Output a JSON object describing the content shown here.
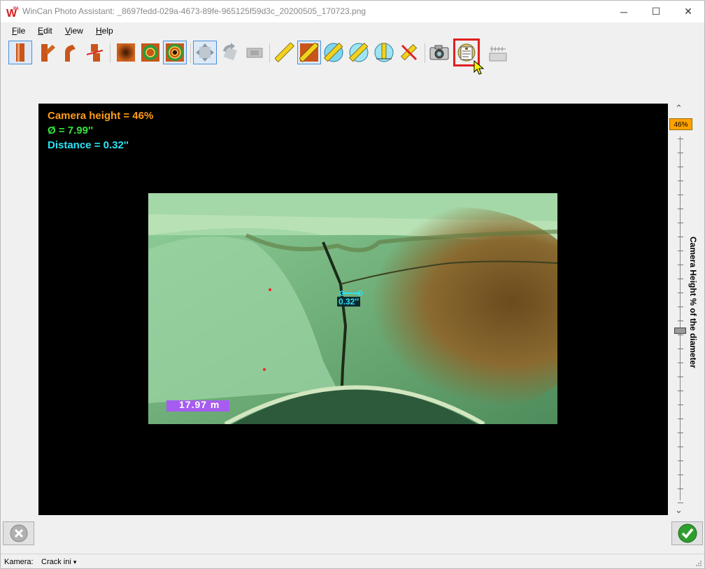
{
  "window": {
    "title": "WinCan Photo Assistant: _8697fedd-029a-4673-89fe-965125f59d3c_20200505_170723.png",
    "minimize_glyph": "─",
    "maximize_glyph": "☐",
    "close_glyph": "✕"
  },
  "menu": {
    "file": {
      "mnemonic": "F",
      "rest": "ile"
    },
    "edit": {
      "mnemonic": "E",
      "rest": "dit"
    },
    "view": {
      "mnemonic": "V",
      "rest": "iew"
    },
    "help": {
      "mnemonic": "H",
      "rest": "elp"
    }
  },
  "toolbar": {
    "icons": [
      "straight-pipe-icon",
      "y-junction-icon",
      "bend-icon",
      "offset-joint-icon",
      "square-view-icon",
      "round-view-icon",
      "round-view-double-icon",
      "move-icon",
      "rotate-icon",
      "frame-icon",
      "measure-ruler-icon",
      "measure-diagonal-icon",
      "measure-circle-icon",
      "measure-circle-alt-icon",
      "measure-height-icon",
      "measure-point-icon",
      "camera-icon",
      "report-icon",
      "scale-icon"
    ],
    "selected": [
      "straight-pipe-icon",
      "round-view-double-icon",
      "move-icon",
      "measure-diagonal-icon"
    ],
    "highlighted": "report-icon"
  },
  "overlay": {
    "camera_height": "Camera height = 46%",
    "diameter": "Ø = 7.99''",
    "distance": "Distance = 0.32''",
    "colors": {
      "camera_height": "#ff9c1a",
      "diameter": "#36e53a",
      "distance": "#2be3f5"
    }
  },
  "photo": {
    "measure_label": "0.32''",
    "counter_text": "17.97 m"
  },
  "slider": {
    "value_label": "46%",
    "value": 0.46,
    "axis_label": "Camera Height % of the diameter",
    "up_arrow": "⌃",
    "down_arrow": "⌄"
  },
  "status": {
    "camera_label": "Kamera:",
    "camera_value": "Crack ini",
    "dropdown_glyph": "▾"
  },
  "colors": {
    "accent_orange": "#ffa200",
    "highlight_red": "#e02020",
    "selection_blue": "#4a90d9",
    "ok_green": "#2e9e2e"
  }
}
